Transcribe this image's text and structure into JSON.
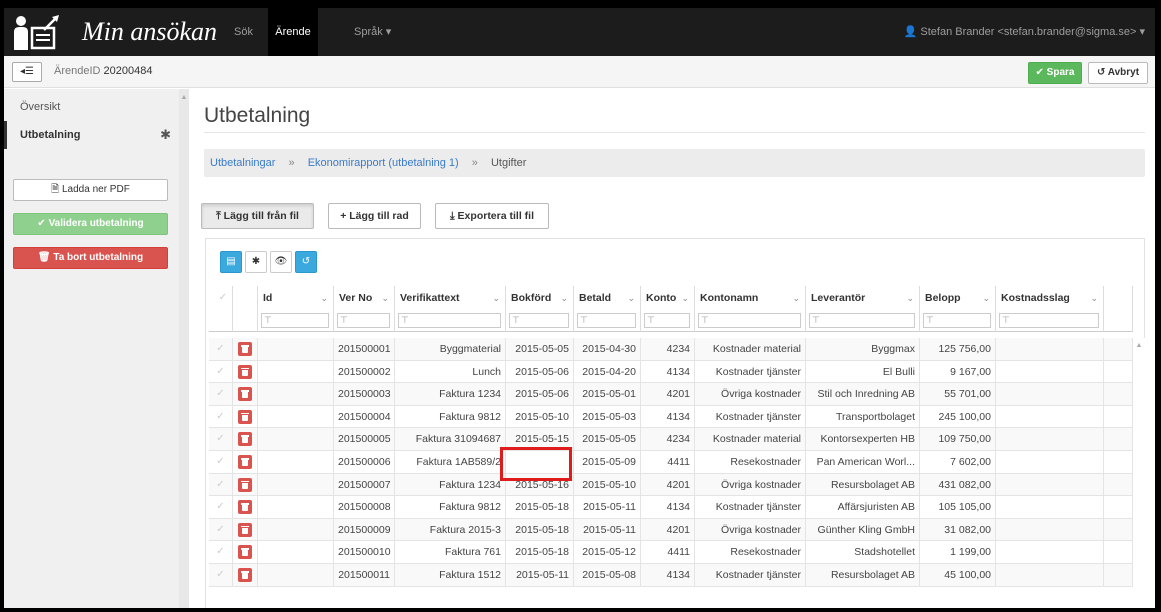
{
  "navbar": {
    "brand_title": "Min ansökan",
    "links": {
      "sok": "Sök",
      "arende": "Ärende",
      "sprak": "Språk ▾"
    },
    "user": "👤 Stefan Brander <stefan.brander@sigma.se> ▾"
  },
  "subheader": {
    "toggle_label": "◂☰",
    "arende_label": "ÄrendeID",
    "arende_id": "20200484",
    "spara_label": "✔ Spara",
    "avbryt_label": "↺ Avbryt"
  },
  "sidebar": {
    "items": [
      {
        "label": "Översikt"
      },
      {
        "label": "Utbetalning",
        "marker": "✱"
      }
    ],
    "buttons": {
      "ladda": "🗎 Ladda ner PDF",
      "validera": "✔ Validera utbetalning",
      "tabort": "🗑 Ta bort utbetalning"
    }
  },
  "main": {
    "title": "Utbetalning",
    "breadcrumb": {
      "items": [
        "Utbetalningar",
        "Ekonomirapport (utbetalning 1)",
        "Utgifter"
      ],
      "separator": "»"
    },
    "toolbar": {
      "lagg_fil": "⤒ Lägg till från fil",
      "lagg_rad": "+ Lägg till rad",
      "exportera": "⤓ Exportera till fil"
    },
    "grid_toolbar": [
      "▤",
      "✱",
      "👁",
      "↺"
    ],
    "grid": {
      "columns": [
        "Id",
        "Ver No",
        "Verifikattext",
        "Bokförd",
        "Betald",
        "Konto",
        "Kontonamn",
        "Leverantör",
        "Belopp",
        "Kostnadsslag"
      ],
      "filter_glyph": "⊤",
      "check_glyph": "✓",
      "rows": [
        {
          "verno": "201500001",
          "text": "Byggmaterial",
          "bokford": "2015-05-05",
          "betald": "2015-04-30",
          "konto": "4234",
          "kontonamn": "Kostnader material",
          "leverantor": "Byggmax",
          "belopp": "125 756,00"
        },
        {
          "verno": "201500002",
          "text": "Lunch",
          "bokford": "2015-05-06",
          "betald": "2015-04-20",
          "konto": "4134",
          "kontonamn": "Kostnader tjänster",
          "leverantor": "El Bulli",
          "belopp": "9 167,00"
        },
        {
          "verno": "201500003",
          "text": "Faktura 1234",
          "bokford": "2015-05-06",
          "betald": "2015-05-01",
          "konto": "4201",
          "kontonamn": "Övriga kostnader",
          "leverantor": "Stil och Inredning AB",
          "belopp": "55 701,00"
        },
        {
          "verno": "201500004",
          "text": "Faktura 9812",
          "bokford": "2015-05-10",
          "betald": "2015-05-03",
          "konto": "4134",
          "kontonamn": "Kostnader tjänster",
          "leverantor": "Transportbolaget",
          "belopp": "245 100,00"
        },
        {
          "verno": "201500005",
          "text": "Faktura 31094687",
          "bokford": "2015-05-15",
          "betald": "2015-05-05",
          "konto": "4234",
          "kontonamn": "Kostnader material",
          "leverantor": "Kontorsexperten HB",
          "belopp": "109 750,00"
        },
        {
          "verno": "201500006",
          "text": "Faktura 1AB589/2",
          "bokford": "",
          "betald": "2015-05-09",
          "konto": "4411",
          "kontonamn": "Resekostnader",
          "leverantor": "Pan American Worl...",
          "belopp": "7 602,00"
        },
        {
          "verno": "201500007",
          "text": "Faktura 1234",
          "bokford": "2015-05-16",
          "betald": "2015-05-10",
          "konto": "4201",
          "kontonamn": "Övriga kostnader",
          "leverantor": "Resursbolaget AB",
          "belopp": "431 082,00"
        },
        {
          "verno": "201500008",
          "text": "Faktura 9812",
          "bokford": "2015-05-18",
          "betald": "2015-05-11",
          "konto": "4134",
          "kontonamn": "Kostnader tjänster",
          "leverantor": "Affärsjuristen AB",
          "belopp": "105 105,00"
        },
        {
          "verno": "201500009",
          "text": "Faktura 2015-3",
          "bokford": "2015-05-18",
          "betald": "2015-05-11",
          "konto": "4201",
          "kontonamn": "Övriga kostnader",
          "leverantor": "Günther Kling GmbH",
          "belopp": "31 082,00"
        },
        {
          "verno": "201500010",
          "text": "Faktura 761",
          "bokford": "2015-05-18",
          "betald": "2015-05-12",
          "konto": "4411",
          "kontonamn": "Resekostnader",
          "leverantor": "Stadshotellet",
          "belopp": "1 199,00"
        },
        {
          "verno": "201500011",
          "text": "Faktura 1512",
          "bokford": "2015-05-11",
          "betald": "2015-05-08",
          "konto": "4134",
          "kontonamn": "Kostnader tjänster",
          "leverantor": "Resursbolaget AB",
          "belopp": "45 100,00"
        }
      ]
    }
  },
  "colors": {
    "navbar": "#1c1c1c",
    "success": "#5cb85c",
    "danger": "#d9534f",
    "info": "#3ca9de",
    "highlight": "#e01b1b"
  }
}
